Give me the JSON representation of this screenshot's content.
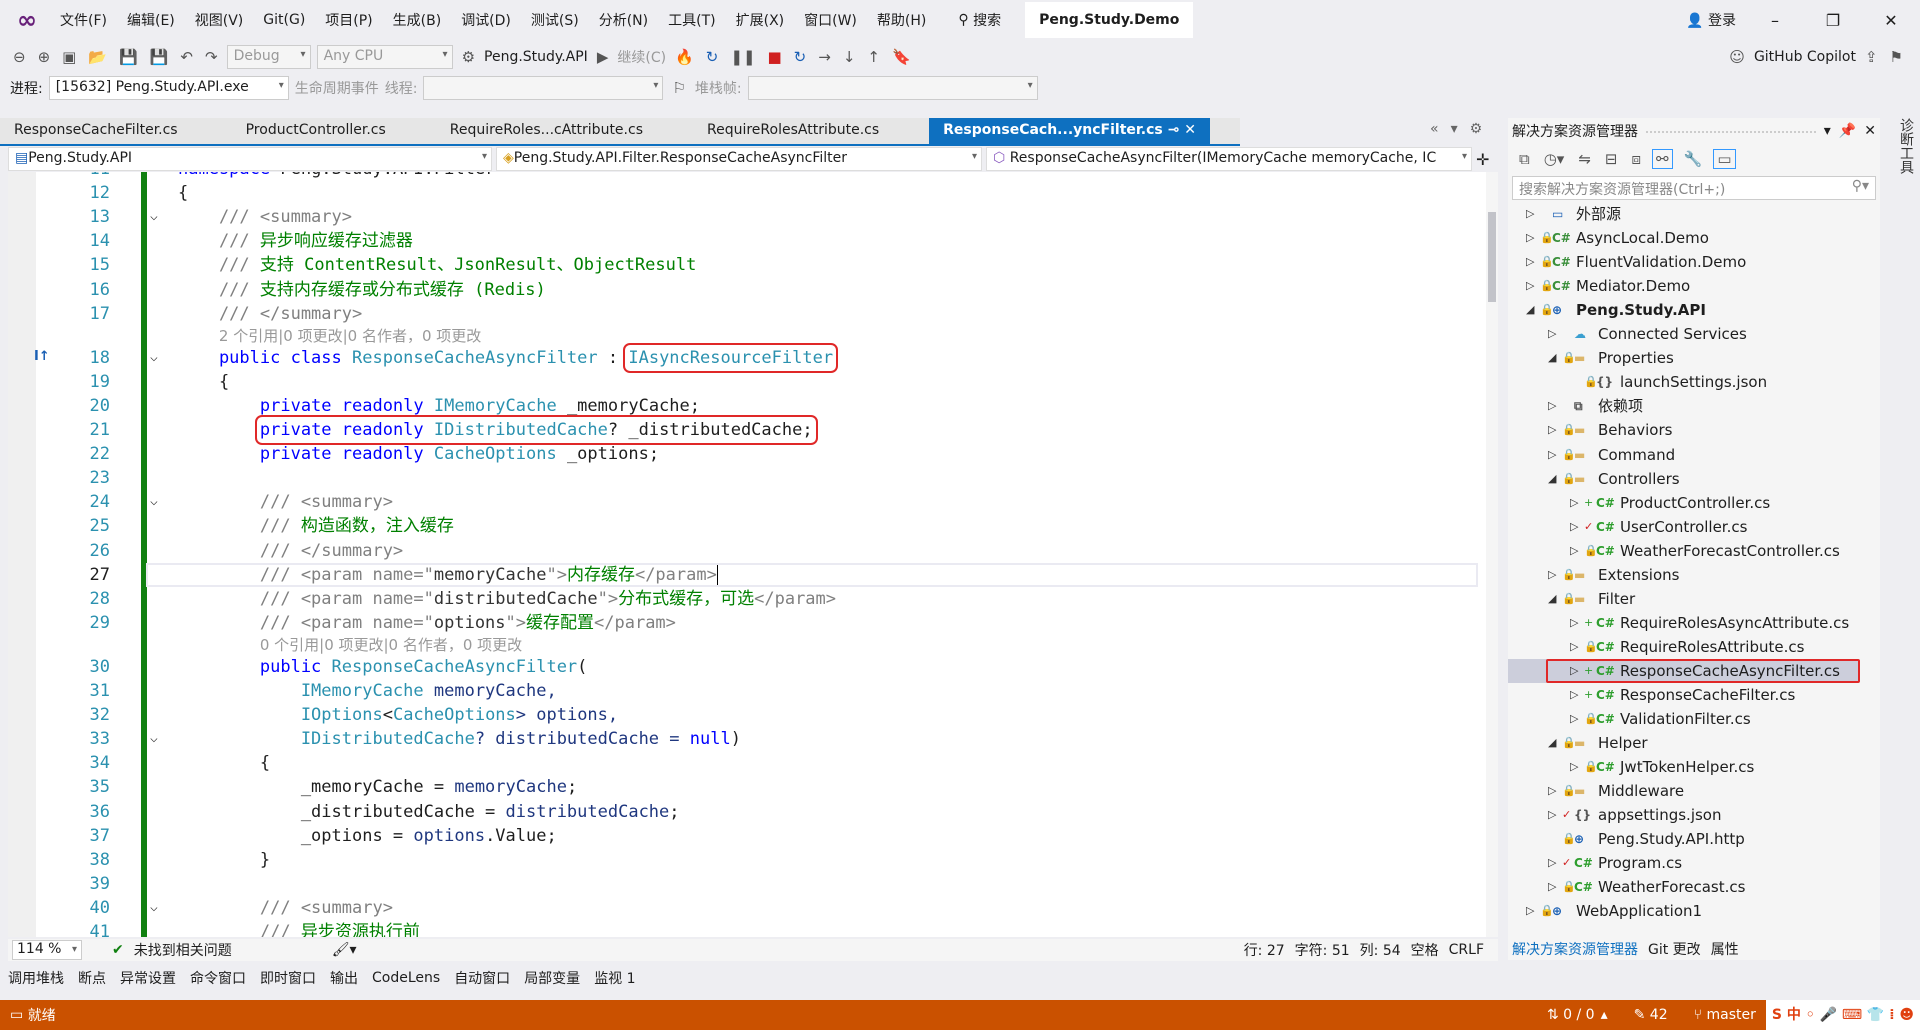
{
  "menu": {
    "items": [
      "文件(F)",
      "编辑(E)",
      "视图(V)",
      "Git(G)",
      "项目(P)",
      "生成(B)",
      "调试(D)",
      "测试(S)",
      "分析(N)",
      "工具(T)",
      "扩展(X)",
      "窗口(W)",
      "帮助(H)"
    ],
    "search": "搜索",
    "solution_title": "Peng.Study.Demo",
    "login": "登录"
  },
  "toolbar": {
    "config": "Debug",
    "platform": "Any CPU",
    "startup": "Peng.Study.API",
    "continue": "继续(C)",
    "copilot": "GitHub Copilot"
  },
  "debugbar": {
    "process_label": "进程:",
    "process": "[15632] Peng.Study.API.exe",
    "lifecycle": "生命周期事件",
    "thread_label": "线程:",
    "stack_label": "堆栈帧:"
  },
  "tabs": [
    {
      "label": "ResponseCacheFilter.cs"
    },
    {
      "label": "ProductController.cs"
    },
    {
      "label": "RequireRoles...cAttribute.cs"
    },
    {
      "label": "RequireRolesAttribute.cs"
    },
    {
      "label": "ResponseCach...yncFilter.cs",
      "active": true
    }
  ],
  "nav": {
    "project": "Peng.Study.API",
    "type": "Peng.Study.API.Filter.ResponseCacheAsyncFilter",
    "member": "ResponseCacheAsyncFilter(IMemoryCache memoryCache, IC"
  },
  "code": [
    {
      "n": "11",
      "t": [
        [
          "namespace ",
          "kw"
        ],
        [
          "Peng.Study.API.Filter",
          "id"
        ]
      ]
    },
    {
      "n": "12",
      "t": [
        [
          "{",
          "id"
        ]
      ]
    },
    {
      "n": "13",
      "fold": true,
      "t": [
        [
          "    /// <summary>",
          "doc"
        ]
      ]
    },
    {
      "n": "14",
      "t": [
        [
          "    /// ",
          "doc"
        ],
        [
          "异步响应缓存过滤器",
          "cm"
        ]
      ]
    },
    {
      "n": "15",
      "t": [
        [
          "    /// ",
          "doc"
        ],
        [
          "支持 ContentResult、JsonResult、ObjectResult",
          "cm"
        ]
      ]
    },
    {
      "n": "16",
      "t": [
        [
          "    /// ",
          "doc"
        ],
        [
          "支持内存缓存或分布式缓存 (Redis)",
          "cm"
        ]
      ]
    },
    {
      "n": "17",
      "t": [
        [
          "    /// </summary>",
          "doc"
        ]
      ]
    },
    {
      "lens": "2 个引用|0 项更改|0 名作者，0 项更改",
      "indent": 4
    },
    {
      "n": "18",
      "fold": true,
      "t": [
        [
          "    public class ",
          "kw"
        ],
        [
          "ResponseCacheAsyncFilter",
          "ty"
        ],
        [
          " : ",
          "id"
        ],
        [
          "IAsyncResourceFilter",
          "ty",
          1
        ]
      ]
    },
    {
      "n": "19",
      "t": [
        [
          "    {",
          "id"
        ]
      ]
    },
    {
      "n": "20",
      "t": [
        [
          "        private readonly ",
          "kw"
        ],
        [
          "IMemoryCache",
          "ty"
        ],
        [
          " _memoryCache;",
          "id"
        ]
      ]
    },
    {
      "n": "21",
      "t": [
        [
          "        ",
          "id"
        ],
        [
          "private readonly ",
          "kw",
          1
        ],
        [
          "IDistributedCache",
          "ty",
          1
        ],
        [
          "? _distributedCache;",
          "id",
          1
        ]
      ]
    },
    {
      "n": "22",
      "t": [
        [
          "        private readonly ",
          "kw"
        ],
        [
          "CacheOptions",
          "ty"
        ],
        [
          " _options;",
          "id"
        ]
      ]
    },
    {
      "n": "23",
      "t": []
    },
    {
      "n": "24",
      "fold": true,
      "t": [
        [
          "        /// <summary>",
          "doc"
        ]
      ]
    },
    {
      "n": "25",
      "t": [
        [
          "        /// ",
          "doc"
        ],
        [
          "构造函数，注入缓存",
          "cm"
        ]
      ]
    },
    {
      "n": "26",
      "t": [
        [
          "        /// </summary>",
          "doc"
        ]
      ]
    },
    {
      "n": "27",
      "cur": true,
      "t": [
        [
          "        /// <param name=\"",
          "doc"
        ],
        [
          "memoryCache",
          "at"
        ],
        [
          "\">",
          "doc"
        ],
        [
          "内存缓存",
          "cm"
        ],
        [
          "</param>",
          "doc"
        ]
      ]
    },
    {
      "n": "28",
      "t": [
        [
          "        /// <param name=\"",
          "doc"
        ],
        [
          "distributedCache",
          "at"
        ],
        [
          "\">",
          "doc"
        ],
        [
          "分布式缓存，可选",
          "cm"
        ],
        [
          "</param>",
          "doc"
        ]
      ]
    },
    {
      "n": "29",
      "t": [
        [
          "        /// <param name=\"",
          "doc"
        ],
        [
          "options",
          "at"
        ],
        [
          "\">",
          "doc"
        ],
        [
          "缓存配置",
          "cm"
        ],
        [
          "</param>",
          "doc"
        ]
      ]
    },
    {
      "lens": "0 个引用|0 项更改|0 名作者，0 项更改",
      "indent": 8
    },
    {
      "n": "30",
      "t": [
        [
          "        public ",
          "kw"
        ],
        [
          "ResponseCacheAsyncFilter",
          "ty"
        ],
        [
          "(",
          "id"
        ]
      ]
    },
    {
      "n": "31",
      "t": [
        [
          "            IMemoryCache",
          "ty"
        ],
        [
          " memoryCache,",
          "pa"
        ]
      ]
    },
    {
      "n": "32",
      "t": [
        [
          "            IOptions",
          "ty"
        ],
        [
          "<",
          "id"
        ],
        [
          "CacheOptions",
          "ty"
        ],
        [
          "> options,",
          "pa"
        ]
      ]
    },
    {
      "n": "33",
      "fold": true,
      "t": [
        [
          "            IDistributedCache",
          "ty"
        ],
        [
          "? distributedCache = ",
          "pa"
        ],
        [
          "null",
          "kw"
        ],
        [
          ")",
          "id"
        ]
      ]
    },
    {
      "n": "34",
      "t": [
        [
          "        {",
          "id"
        ]
      ]
    },
    {
      "n": "35",
      "t": [
        [
          "            _memoryCache = ",
          "id"
        ],
        [
          "memoryCache",
          "pa"
        ],
        [
          ";",
          "id"
        ]
      ]
    },
    {
      "n": "36",
      "t": [
        [
          "            _distributedCache = ",
          "id"
        ],
        [
          "distributedCache",
          "pa"
        ],
        [
          ";",
          "id"
        ]
      ]
    },
    {
      "n": "37",
      "t": [
        [
          "            _options = ",
          "id"
        ],
        [
          "options",
          "pa"
        ],
        [
          ".Value;",
          "id"
        ]
      ]
    },
    {
      "n": "38",
      "t": [
        [
          "        }",
          "id"
        ]
      ]
    },
    {
      "n": "39",
      "t": []
    },
    {
      "n": "40",
      "fold": true,
      "t": [
        [
          "        /// <summary>",
          "doc"
        ]
      ]
    },
    {
      "n": "41",
      "t": [
        [
          "        /// ",
          "doc"
        ],
        [
          "异步资源执行前",
          "cm"
        ]
      ]
    }
  ],
  "editor_status": {
    "zoom": "114 %",
    "issues": "未找到相关问题",
    "line": "行: 27",
    "char": "字符: 51",
    "col": "列: 54",
    "indent": "空格",
    "eol": "CRLF"
  },
  "solution_explorer": {
    "title": "解决方案资源管理器",
    "search_placeholder": "搜索解决方案资源管理器(Ctrl+;)",
    "items": [
      {
        "l": 0,
        "e": "c",
        "b": "",
        "i": "ext",
        "label": "外部源"
      },
      {
        "l": 0,
        "e": "c",
        "b": "lock",
        "i": "csproj",
        "label": "AsyncLocal.Demo"
      },
      {
        "l": 0,
        "e": "c",
        "b": "lock",
        "i": "csproj",
        "label": "FluentValidation.Demo"
      },
      {
        "l": 0,
        "e": "c",
        "b": "lock",
        "i": "csproj",
        "label": "Mediator.Demo"
      },
      {
        "l": 0,
        "e": "o",
        "b": "lock",
        "i": "web",
        "label": "Peng.Study.API",
        "bold": true
      },
      {
        "l": 1,
        "e": "c",
        "b": "",
        "i": "cloud",
        "label": "Connected Services"
      },
      {
        "l": 1,
        "e": "o",
        "b": "lock",
        "i": "folder",
        "label": "Properties"
      },
      {
        "l": 2,
        "e": "",
        "b": "lock",
        "i": "json",
        "label": "launchSettings.json"
      },
      {
        "l": 1,
        "e": "c",
        "b": "",
        "i": "deps",
        "label": "依赖项"
      },
      {
        "l": 1,
        "e": "c",
        "b": "lock",
        "i": "folder",
        "label": "Behaviors"
      },
      {
        "l": 1,
        "e": "c",
        "b": "lock",
        "i": "folder",
        "label": "Command"
      },
      {
        "l": 1,
        "e": "o",
        "b": "lock",
        "i": "folder",
        "label": "Controllers"
      },
      {
        "l": 2,
        "e": "c",
        "b": "plus",
        "i": "cs",
        "label": "ProductController.cs"
      },
      {
        "l": 2,
        "e": "c",
        "b": "check",
        "i": "cs",
        "label": "UserController.cs"
      },
      {
        "l": 2,
        "e": "c",
        "b": "lock",
        "i": "cs",
        "label": "WeatherForecastController.cs"
      },
      {
        "l": 1,
        "e": "c",
        "b": "lock",
        "i": "folder",
        "label": "Extensions"
      },
      {
        "l": 1,
        "e": "o",
        "b": "lock",
        "i": "folder",
        "label": "Filter"
      },
      {
        "l": 2,
        "e": "c",
        "b": "plus",
        "i": "cs",
        "label": "RequireRolesAsyncAttribute.cs"
      },
      {
        "l": 2,
        "e": "c",
        "b": "lock",
        "i": "cs",
        "label": "RequireRolesAttribute.cs"
      },
      {
        "l": 2,
        "e": "c",
        "b": "plus",
        "i": "cs",
        "label": "ResponseCacheAsyncFilter.cs",
        "selected": true
      },
      {
        "l": 2,
        "e": "c",
        "b": "plus",
        "i": "cs",
        "label": "ResponseCacheFilter.cs"
      },
      {
        "l": 2,
        "e": "c",
        "b": "lock",
        "i": "cs",
        "label": "ValidationFilter.cs"
      },
      {
        "l": 1,
        "e": "o",
        "b": "lock",
        "i": "folder",
        "label": "Helper"
      },
      {
        "l": 2,
        "e": "c",
        "b": "lock",
        "i": "cs",
        "label": "JwtTokenHelper.cs"
      },
      {
        "l": 1,
        "e": "c",
        "b": "lock",
        "i": "folder",
        "label": "Middleware"
      },
      {
        "l": 1,
        "e": "c",
        "b": "check",
        "i": "json",
        "label": "appsettings.json"
      },
      {
        "l": 1,
        "e": "",
        "b": "lock",
        "i": "http",
        "label": "Peng.Study.API.http"
      },
      {
        "l": 1,
        "e": "c",
        "b": "check",
        "i": "cs",
        "label": "Program.cs"
      },
      {
        "l": 1,
        "e": "c",
        "b": "lock",
        "i": "cs",
        "label": "WeatherForecast.cs"
      },
      {
        "l": 0,
        "e": "c",
        "b": "lock",
        "i": "web",
        "label": "WebApplication1"
      }
    ],
    "bottom_tabs": [
      "解决方案资源管理器",
      "Git 更改",
      "属性"
    ]
  },
  "bottom_tabs": [
    "调用堆栈",
    "断点",
    "异常设置",
    "命令窗口",
    "即时窗口",
    "输出",
    "CodeLens",
    "自动窗口",
    "局部变量",
    "监视 1"
  ],
  "right_strip": "诊断工具",
  "status": {
    "ready": "就绪",
    "sync": "0 / 0",
    "edits": "42",
    "branch": "master"
  },
  "colors": {
    "accent": "#0e70c0",
    "status_bar": "#ca5100",
    "highlight_box": "#e02828",
    "change_bar": "#108010"
  }
}
